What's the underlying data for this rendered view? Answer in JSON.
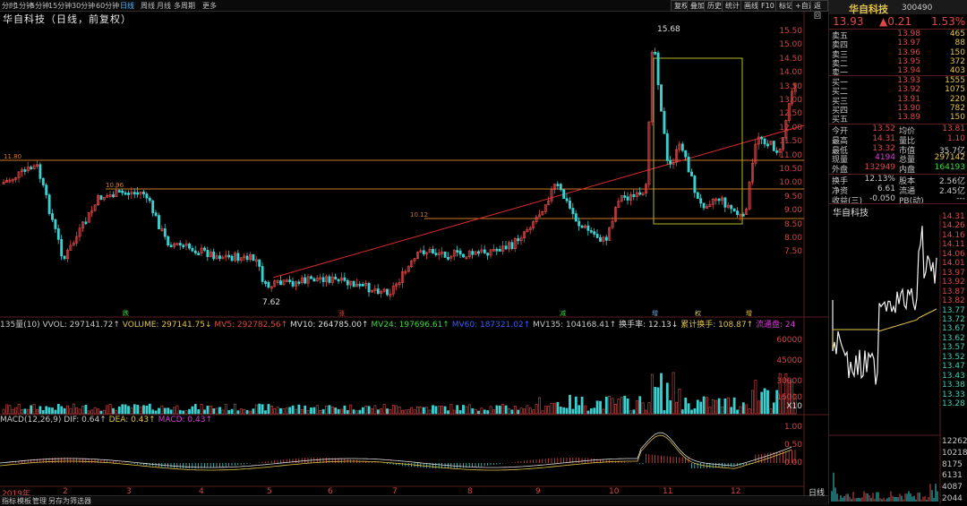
{
  "toolbar": {
    "items": [
      "分时",
      "1分钟",
      "5分钟",
      "15分钟",
      "30分钟",
      "60分钟",
      "日线",
      "周线",
      "月线",
      "多周期",
      "更多"
    ],
    "active": "日线",
    "right": [
      "复权",
      "叠加",
      "历史",
      "统计",
      "画线",
      "F10",
      "标记",
      "+自选",
      "返回"
    ]
  },
  "chart": {
    "title": "华自科技（日线，前复权）",
    "price_axis": [
      "15.50",
      "15.00",
      "14.50",
      "14.00",
      "13.50",
      "13.00",
      "12.50",
      "12.00",
      "11.50",
      "11.00",
      "10.50",
      "10.00",
      "9.50",
      "9.00",
      "8.50",
      "8.00",
      "7.50"
    ],
    "annotations": {
      "high": "15.68",
      "low": "7.62",
      "level1": "11.80",
      "level2": "10.96",
      "level3": "10.12"
    },
    "markers": [
      "跌",
      "涨",
      "减",
      "增",
      "权",
      "增"
    ]
  },
  "volume": {
    "indicators": [
      {
        "text": "135量(10) VVOL: 297141.72↑",
        "color": "#c8c8c8"
      },
      {
        "text": " VOLUME: 297141.75↓",
        "color": "#e2c34a"
      },
      {
        "text": " MV5: 292782.56↑",
        "color": "#e04848"
      },
      {
        "text": " MV10: 264785.00↑",
        "color": "#dcdcdc"
      },
      {
        "text": " MV24: 197696.61↑",
        "color": "#3adc3a"
      },
      {
        "text": " MV60: 187321.02↑",
        "color": "#3b5cff"
      },
      {
        "text": " MV135: 104168.41↑",
        "color": "#c8c8c8"
      },
      {
        "text": " 换手率: 12.13↓",
        "color": "#dcdcdc"
      },
      {
        "text": " 累计换手: 108.87↑",
        "color": "#e2c34a"
      },
      {
        "text": " 流通盘: 24",
        "color": "#d83bd8"
      }
    ],
    "axis": [
      "60000",
      "45000",
      "30000",
      "15000",
      "X10"
    ]
  },
  "macd": {
    "indicators": [
      {
        "text": "MACD(12,26,9) DIF: 0.64↑",
        "color": "#c8c8c8"
      },
      {
        "text": " DEA: 0.43↑",
        "color": "#e2c34a"
      },
      {
        "text": " MACD: 0.43↑",
        "color": "#d83bd8"
      }
    ],
    "axis": [
      "1.00",
      "0.50",
      "0.00"
    ]
  },
  "months": [
    "2019年",
    "2",
    "3",
    "4",
    "5",
    "6",
    "7",
    "8",
    "9",
    "10",
    "11",
    "12"
  ],
  "bottom_tabs": [
    "指标",
    "模板",
    "管理",
    "另存为",
    "筛选器"
  ],
  "bottom_right": "日线",
  "quote": {
    "name": "华自科技",
    "code": "300490",
    "price": "13.93",
    "change": "▲0.21",
    "pct": "1.53%",
    "asks": [
      {
        "label": "卖五",
        "price": "13.98",
        "vol": "465"
      },
      {
        "label": "卖四",
        "price": "13.97",
        "vol": "88"
      },
      {
        "label": "卖三",
        "price": "13.96",
        "vol": "150"
      },
      {
        "label": "卖二",
        "price": "13.95",
        "vol": "372"
      },
      {
        "label": "卖一",
        "price": "13.94",
        "vol": "403"
      }
    ],
    "bids": [
      {
        "label": "买一",
        "price": "13.93",
        "vol": "1555"
      },
      {
        "label": "买二",
        "price": "13.92",
        "vol": "1075"
      },
      {
        "label": "买三",
        "price": "13.91",
        "vol": "220"
      },
      {
        "label": "买四",
        "price": "13.90",
        "vol": "782"
      },
      {
        "label": "买五",
        "price": "13.89",
        "vol": "150"
      }
    ],
    "stats1": [
      {
        "l1": "今开",
        "v1": "13.52",
        "c1": "#e04848",
        "l2": "均价",
        "v2": "13.81",
        "c2": "#e04848"
      },
      {
        "l1": "最高",
        "v1": "14.31",
        "c1": "#e04848",
        "l2": "量比",
        "v2": "1.10",
        "c2": "#e04848"
      },
      {
        "l1": "最低",
        "v1": "13.32",
        "c1": "#e04848",
        "l2": "市值",
        "v2": "35.7亿",
        "c2": "#c8c8c8"
      },
      {
        "l1": "现量",
        "v1": "4194",
        "c1": "#d83bd8",
        "l2": "总量",
        "v2": "297142",
        "c2": "#e2c34a"
      },
      {
        "l1": "外盘",
        "v1": "132949",
        "c1": "#e04848",
        "l2": "内盘",
        "v2": "164193",
        "c2": "#3adc3a"
      }
    ],
    "stats2": [
      {
        "l1": "换手",
        "v1": "12.13%",
        "c1": "#c8c8c8",
        "l2": "股本",
        "v2": "2.56亿",
        "c2": "#c8c8c8"
      },
      {
        "l1": "净资",
        "v1": "6.61",
        "c1": "#c8c8c8",
        "l2": "流通",
        "v2": "2.45亿",
        "c2": "#c8c8c8"
      },
      {
        "l1": "收益(三)",
        "v1": "-0.050",
        "c1": "#c8c8c8",
        "l2": "PB(动)",
        "v2": "---",
        "c2": "#c8c8c8"
      }
    ]
  },
  "intraday": {
    "title": "华自科技",
    "price_axis": [
      "14.31",
      "14.26",
      "14.16",
      "14.11",
      "14.06",
      "14.01",
      "13.97",
      "13.92",
      "13.87",
      "13.82",
      "13.77",
      "13.72",
      "13.67",
      "13.62",
      "13.57",
      "13.52",
      "13.47",
      "13.43",
      "13.38",
      "13.33",
      "13.28"
    ],
    "vol_axis": [
      "12262",
      "10218",
      "8175",
      "6131",
      "4087",
      "2044"
    ]
  }
}
